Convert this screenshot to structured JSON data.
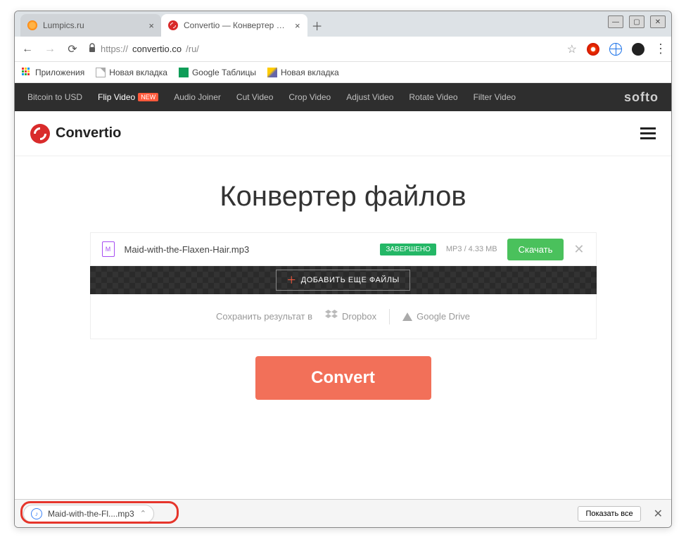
{
  "window": {
    "min_tip": "—",
    "max_tip": "▢",
    "close_tip": "✕"
  },
  "tabs": {
    "items": [
      {
        "label": "Lumpics.ru"
      },
      {
        "label": "Convertio — Конвертер файлов"
      }
    ],
    "new": "＋"
  },
  "addr": {
    "back": "←",
    "fwd": "→",
    "reload": "⟳",
    "lock": "🔒",
    "proto": "https://",
    "host": "convertio.co",
    "path": "/ru/",
    "star": "☆",
    "dots": "⋮"
  },
  "bookmarks": {
    "apps": "Приложения",
    "items": [
      {
        "label": "Новая вкладка",
        "ico": "doc"
      },
      {
        "label": "Google Таблицы",
        "ico": "sheets"
      },
      {
        "label": "Новая вкладка",
        "ico": "img"
      }
    ]
  },
  "topnav": {
    "items": [
      {
        "label": "Bitcoin to USD"
      },
      {
        "label": "Flip Video",
        "badge": "NEW",
        "active": true
      },
      {
        "label": "Audio Joiner"
      },
      {
        "label": "Cut Video"
      },
      {
        "label": "Crop Video"
      },
      {
        "label": "Adjust Video"
      },
      {
        "label": "Rotate Video"
      },
      {
        "label": "Filter Video"
      }
    ],
    "brand": "softo"
  },
  "header": {
    "brand": "Convertio"
  },
  "hero": "Конвертер файлов",
  "file": {
    "icon_letter": "M",
    "name": "Maid-with-the-Flaxen-Hair.mp3",
    "status": "ЗАВЕРШЕНО",
    "meta": "MP3 / 4.33 MB",
    "download": "Скачать",
    "close": "✕"
  },
  "add_more": {
    "plus": "＋",
    "label": "ДОБАВИТЬ ЕЩЕ ФАЙЛЫ"
  },
  "save": {
    "prefix": "Сохранить результат в",
    "dropbox": "Dropbox",
    "gdrive": "Google Drive"
  },
  "convert": "Convert",
  "dlbar": {
    "file": "Maid-with-the-Fl....mp3",
    "caret": "⌃",
    "showall": "Показать все",
    "close": "✕"
  }
}
